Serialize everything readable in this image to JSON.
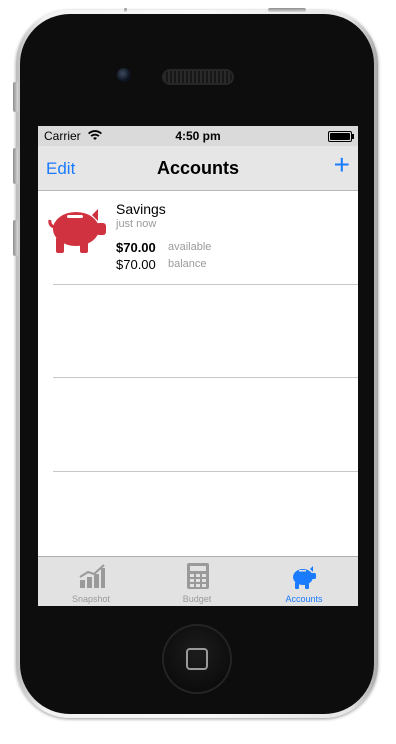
{
  "status_bar": {
    "carrier": "Carrier",
    "time": "4:50 pm"
  },
  "nav": {
    "edit_label": "Edit",
    "title": "Accounts",
    "add_label": "+"
  },
  "accounts": [
    {
      "name": "Savings",
      "updated": "just now",
      "available_amount": "$70.00",
      "available_label": "available",
      "balance_amount": "$70.00",
      "balance_label": "balance",
      "icon": "piggy-bank-icon",
      "color": "#d0333f"
    }
  ],
  "tabs": [
    {
      "label": "Snapshot",
      "icon": "chart-icon",
      "active": false
    },
    {
      "label": "Budget",
      "icon": "calculator-icon",
      "active": false
    },
    {
      "label": "Accounts",
      "icon": "piggy-bank-icon",
      "active": true
    }
  ],
  "colors": {
    "accent": "#1a7bff",
    "inactive_tab": "#9a9a9a",
    "account_red": "#d0333f"
  }
}
